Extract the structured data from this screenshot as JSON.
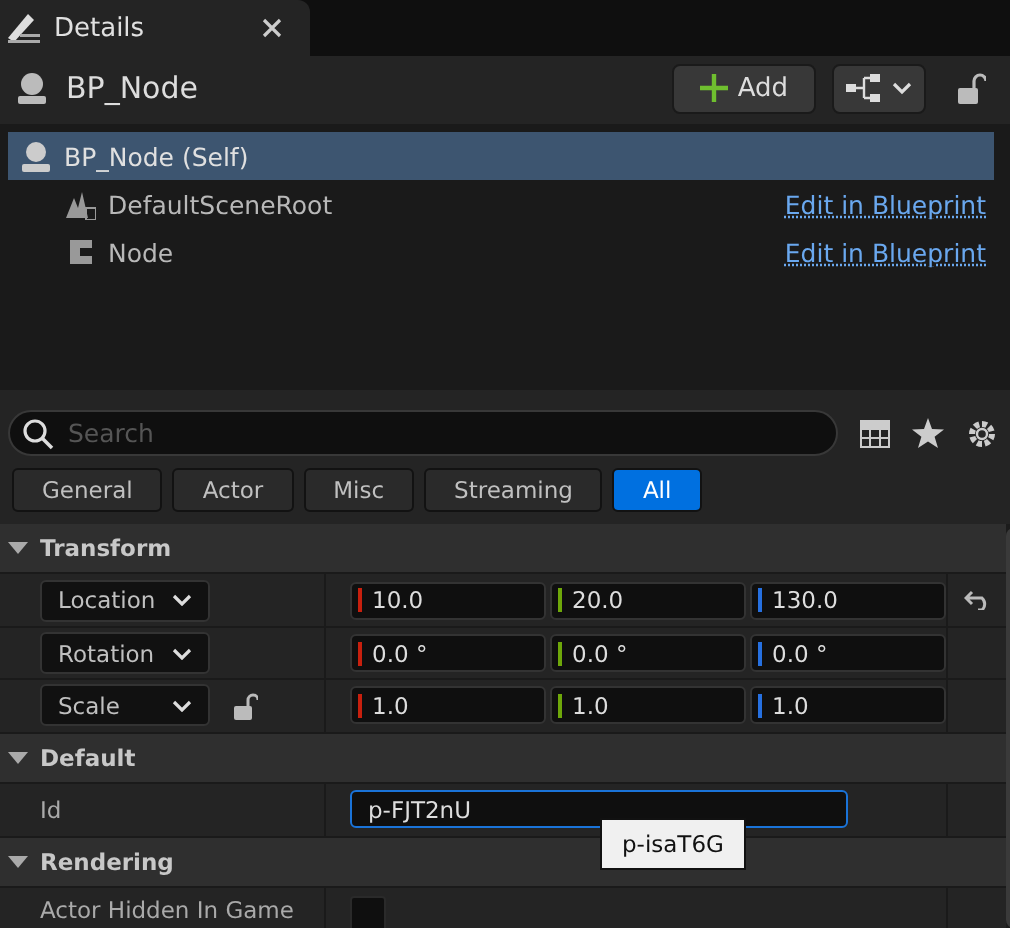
{
  "tab": {
    "title": "Details"
  },
  "header": {
    "title": "BP_Node",
    "add_button": "Add"
  },
  "components": [
    {
      "name": "BP_Node (Self)",
      "kind": "actor",
      "selected": true,
      "children": [
        {
          "name": "DefaultSceneRoot",
          "kind": "scene",
          "selected": false,
          "link": "Edit in Blueprint"
        },
        {
          "name": "Node",
          "kind": "class",
          "selected": false,
          "link": "Edit in Blueprint"
        }
      ]
    }
  ],
  "search": {
    "placeholder": "Search"
  },
  "filters": [
    {
      "label": "General",
      "selected": false
    },
    {
      "label": "Actor",
      "selected": false
    },
    {
      "label": "Misc",
      "selected": false
    },
    {
      "label": "Streaming",
      "selected": false
    },
    {
      "label": "All",
      "selected": true
    }
  ],
  "sections": [
    {
      "title": "Transform",
      "expanded": true,
      "rows": [
        {
          "kind": "vector",
          "label": "Location",
          "values": [
            "10.0",
            "20.0",
            "130.0"
          ],
          "reset": true,
          "lock": false
        },
        {
          "kind": "vector",
          "label": "Rotation",
          "values": [
            "0.0 °",
            "0.0 °",
            "0.0 °"
          ],
          "reset": false,
          "lock": false
        },
        {
          "kind": "vector",
          "label": "Scale",
          "values": [
            "1.0",
            "1.0",
            "1.0"
          ],
          "reset": false,
          "lock": true
        }
      ]
    },
    {
      "title": "Default",
      "expanded": true,
      "rows": [
        {
          "kind": "text",
          "label": "Id",
          "value": "p-FJT2nU",
          "focused": true,
          "suggestion": "p-isaT6G"
        }
      ]
    },
    {
      "title": "Rendering",
      "expanded": true,
      "rows": [
        {
          "kind": "checkbox",
          "label": "Actor Hidden In Game",
          "checked": false
        }
      ]
    }
  ]
}
